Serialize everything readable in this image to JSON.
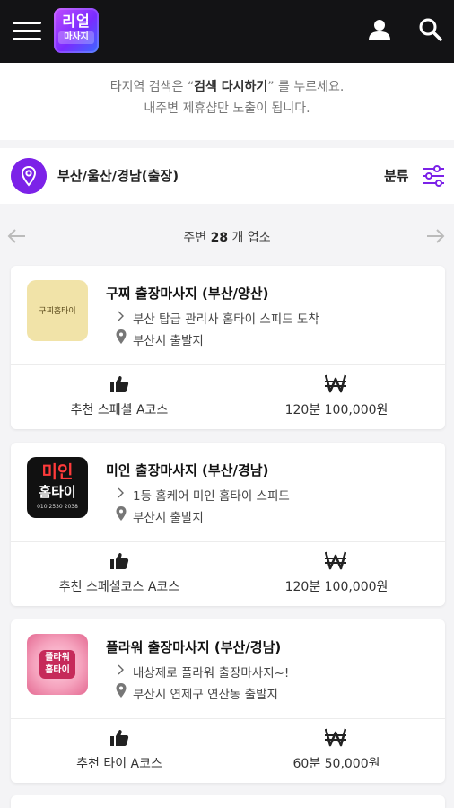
{
  "logo": {
    "line1": "리얼",
    "line2": "마사지"
  },
  "notice": {
    "line1_prefix": "타지역 검색은 “",
    "line1_bold": "검색 다시하기",
    "line1_suffix": "” 를 누르세요.",
    "line2": "내주변 제휴샵만 노출이 됩니다."
  },
  "location": {
    "text": "부산/울산/경남(출장)",
    "category_label": "분류"
  },
  "pager": {
    "prefix": "주변",
    "count": "28",
    "suffix": "개 업소"
  },
  "colors": {
    "topbar": "#131315",
    "accent": "#7c22e8"
  },
  "listings": [
    {
      "title": "구찌 출장마사지 (부산/양산)",
      "desc": "부산 탑급 관리사 홈타이 스피드 도착",
      "location": "부산시 출발지",
      "course": "추천 스페셜 A코스",
      "price": "120분 100,000원",
      "thumb_text": "구찌홈타이"
    },
    {
      "title": "미인 출장마사지 (부산/경남)",
      "desc": "1등 홈케어 미인 홈타이 스피드",
      "location": "부산시 출발지",
      "course": "추천 스페셜코스 A코스",
      "price": "120분 100,000원",
      "thumb_text_line1": "미인",
      "thumb_text_line2": "홈타이",
      "thumb_text_line3": "010 2530 2038"
    },
    {
      "title": "플라워 출장마사지 (부산/경남)",
      "desc": "내상제로 플라워 출장마사지~!",
      "location": "부산시 연제구 연산동 출발지",
      "course": "추천 타이 A코스",
      "price": "60분 50,000원",
      "thumb_text_line1": "플라워",
      "thumb_text_line2": "홈타이"
    }
  ]
}
